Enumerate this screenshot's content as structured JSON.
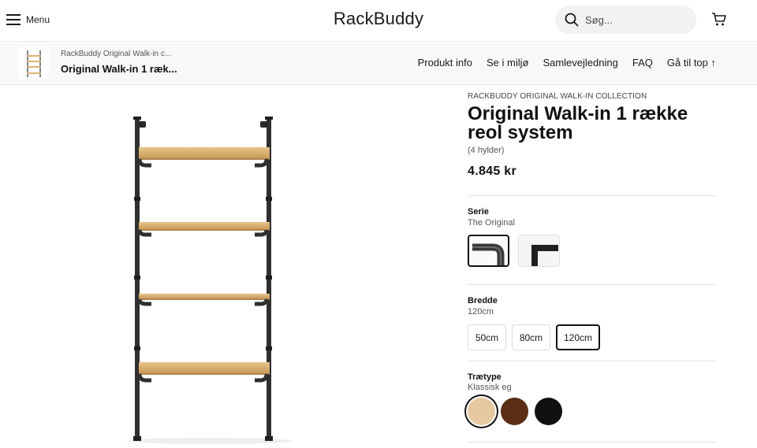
{
  "header": {
    "menu_label": "Menu",
    "logo": "RackBuddy",
    "search_placeholder": "Søg..."
  },
  "subnav": {
    "brand": "RackBuddy Original Walk-in c...",
    "title": "Original Walk-in 1 ræk...",
    "links": [
      "Produkt info",
      "Se i miljø",
      "Samlevejledning",
      "FAQ",
      "Gå til top ↑"
    ]
  },
  "product": {
    "collection": "RACKBUDDY ORIGINAL WALK-IN COLLECTION",
    "title": "Original Walk-in 1 række reol system",
    "subtitle": "(4 hylder)",
    "price": "4.845 kr"
  },
  "options": {
    "serie": {
      "label": "Serie",
      "value": "The Original",
      "choices": [
        "the-original-pipe-icon",
        "square-profile-icon"
      ]
    },
    "bredde": {
      "label": "Bredde",
      "value": "120cm",
      "choices": [
        "50cm",
        "80cm",
        "120cm"
      ]
    },
    "traetype": {
      "label": "Trætype",
      "value": "Klassisk eg",
      "choices": [
        {
          "name": "klassisk-eg",
          "color": "#e6c9a0"
        },
        {
          "name": "dark-wood",
          "color": "#5a2d14"
        },
        {
          "name": "black-wood",
          "color": "#111111"
        }
      ]
    }
  },
  "colors": {
    "wood_shelf": "#d9b275",
    "pipe": "#2f2f2f",
    "accent": "#111111"
  }
}
